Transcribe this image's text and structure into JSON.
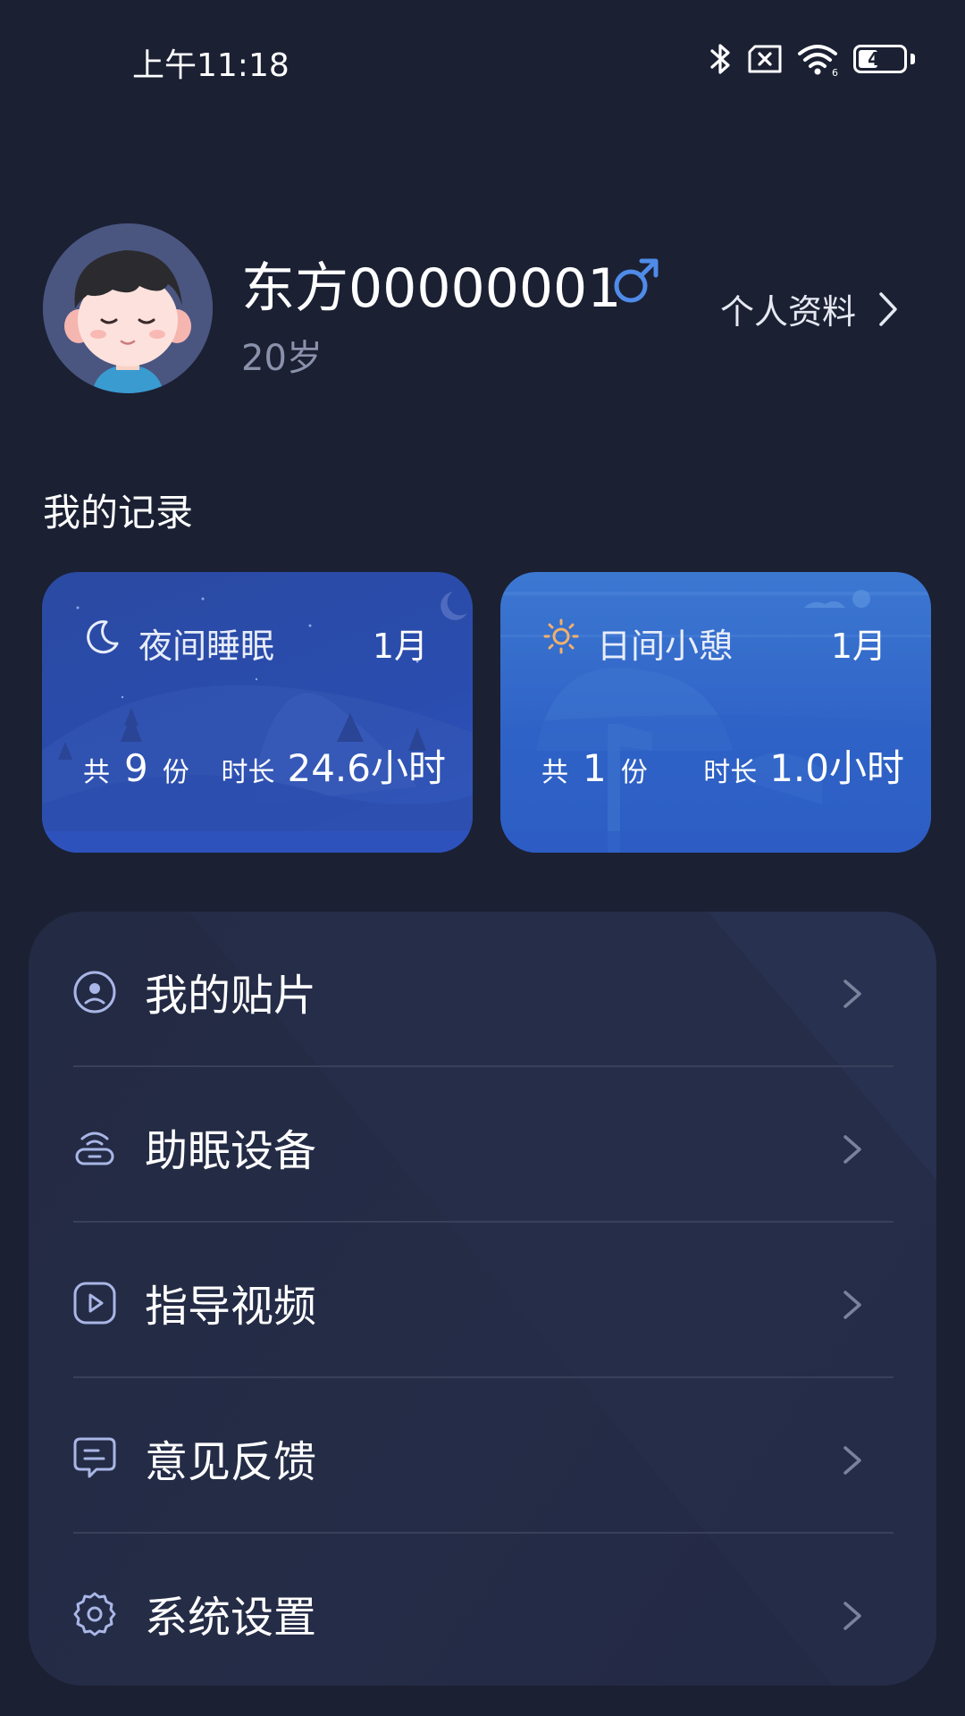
{
  "status_bar": {
    "time": "上午11:18",
    "battery": "43",
    "battery_level": 0.43
  },
  "profile": {
    "name": "东方00000001",
    "age": "20岁",
    "link_label": "个人资料"
  },
  "records": {
    "title": "我的记录",
    "cards": [
      {
        "title": "夜间睡眠",
        "month": "1月",
        "count_prefix": "共",
        "count": "9",
        "count_unit": "份",
        "duration_label": "时长",
        "duration": "24.6小时"
      },
      {
        "title": "日间小憩",
        "month": "1月",
        "count_prefix": "共",
        "count": "1",
        "count_unit": "份",
        "duration_label": "时长",
        "duration": "1.0小时"
      }
    ]
  },
  "menu": {
    "items": [
      {
        "label": "我的贴片",
        "icon": "patch-icon"
      },
      {
        "label": "助眠设备",
        "icon": "device-icon"
      },
      {
        "label": "指导视频",
        "icon": "video-icon"
      },
      {
        "label": "意见反馈",
        "icon": "feedback-icon"
      },
      {
        "label": "系统设置",
        "icon": "gear-icon"
      }
    ]
  },
  "colors": {
    "background": "#1b2033",
    "accent": "#4f8be8",
    "icon": "#a9b6e6",
    "muted": "#8a92ab"
  }
}
